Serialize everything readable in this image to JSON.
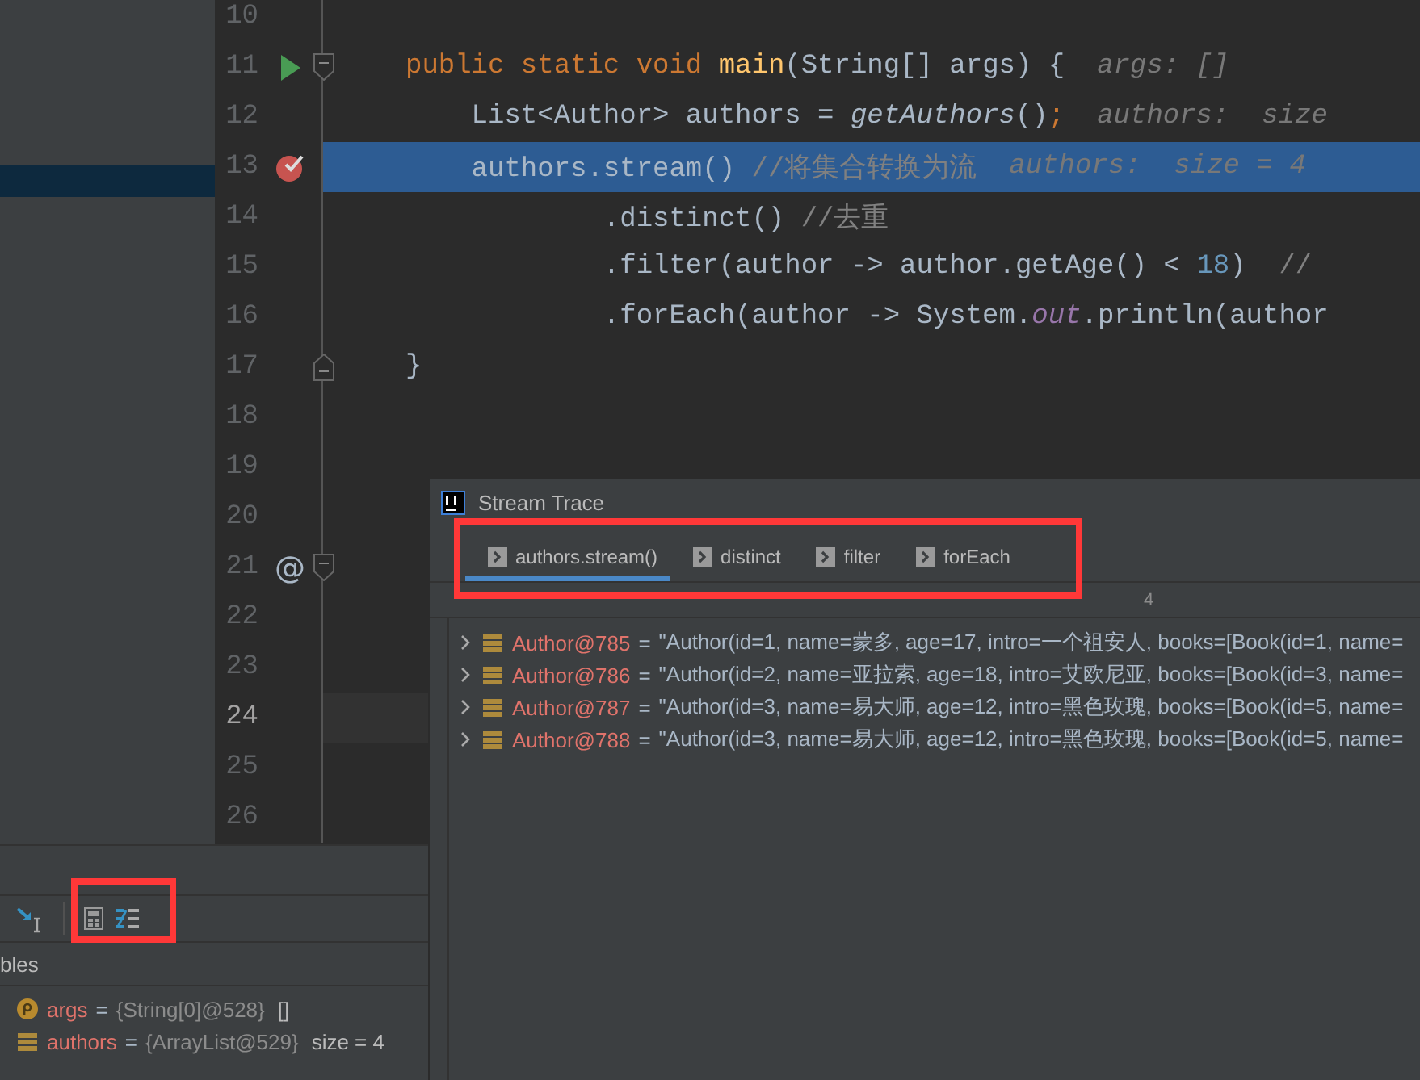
{
  "editor": {
    "lines": [
      {
        "number": "10",
        "current": false,
        "executing": false
      },
      {
        "number": "11",
        "current": false,
        "executing": false,
        "gutter": {
          "kind": "run"
        },
        "fold": {
          "kind": "start"
        },
        "tokens": [
          {
            "kind": "keyword",
            "text": "public static void "
          },
          {
            "kind": "method",
            "text": "main"
          },
          {
            "kind": "plain",
            "text": "(String[] args) {"
          }
        ],
        "hint": "args: []"
      },
      {
        "number": "12",
        "current": false,
        "executing": false,
        "tokens": [
          {
            "kind": "plain",
            "text": "    List<Author> authors = "
          },
          {
            "kind": "call",
            "text": "getAuthors"
          },
          {
            "kind": "plain",
            "text": "()"
          },
          {
            "kind": "keyword",
            "text": ";"
          }
        ],
        "hint": "authors:  size"
      },
      {
        "number": "13",
        "current": false,
        "executing": true,
        "gutter": {
          "kind": "breakpoint"
        },
        "tokens": [
          {
            "kind": "plain",
            "text": "    authors.stream() "
          },
          {
            "kind": "comment",
            "text": "//将集合转换为流"
          }
        ],
        "hint": "authors:  size = 4"
      },
      {
        "number": "14",
        "current": false,
        "executing": false,
        "tokens": [
          {
            "kind": "plain",
            "text": "            .distinct() "
          },
          {
            "kind": "comment",
            "text": "//去重"
          }
        ]
      },
      {
        "number": "15",
        "current": false,
        "executing": false,
        "tokens": [
          {
            "kind": "plain",
            "text": "            .filter(author -> author.getAge() < "
          },
          {
            "kind": "number",
            "text": "18"
          },
          {
            "kind": "plain",
            "text": ")  "
          },
          {
            "kind": "comment",
            "text": "//"
          }
        ]
      },
      {
        "number": "16",
        "current": false,
        "executing": false,
        "tokens": [
          {
            "kind": "plain",
            "text": "            .forEach(author -> System."
          },
          {
            "kind": "field",
            "text": "out"
          },
          {
            "kind": "plain",
            "text": ".println(author"
          }
        ]
      },
      {
        "number": "17",
        "current": false,
        "executing": false,
        "fold": {
          "kind": "end"
        },
        "tokens": [
          {
            "kind": "plain",
            "text": "}"
          }
        ]
      },
      {
        "number": "18",
        "current": false,
        "executing": false
      },
      {
        "number": "19",
        "current": false,
        "executing": false
      },
      {
        "number": "20",
        "current": false,
        "executing": false
      },
      {
        "number": "21",
        "current": false,
        "executing": false,
        "gutter_mark": "@",
        "fold": {
          "kind": "start"
        }
      },
      {
        "number": "22",
        "current": false,
        "executing": false
      },
      {
        "number": "23",
        "current": false,
        "executing": false
      },
      {
        "number": "24",
        "current": true,
        "executing": false
      },
      {
        "number": "25",
        "current": false,
        "executing": false
      },
      {
        "number": "26",
        "current": false,
        "executing": false
      }
    ]
  },
  "debugger": {
    "tab": "bles",
    "variables": [
      {
        "kind": "parameter",
        "name": "args",
        "sign": "=",
        "value": "{String[0]@528}",
        "extra": "[]"
      },
      {
        "kind": "field",
        "name": "authors",
        "sign": "=",
        "value": "{ArrayList@529}",
        "extra": "size = 4"
      }
    ]
  },
  "stream_trace": {
    "title": "Stream Trace",
    "tabs": [
      {
        "label": "authors.stream()",
        "selected": true
      },
      {
        "label": "distinct",
        "selected": false
      },
      {
        "label": "filter",
        "selected": false
      },
      {
        "label": "forEach",
        "selected": false
      }
    ],
    "count": "4",
    "items": [
      {
        "name": "Author@785",
        "sign": "=",
        "value": "\"Author(id=1, name=蒙多, age=17, intro=一个祖安人, books=[Book(id=1, name="
      },
      {
        "name": "Author@786",
        "sign": "=",
        "value": "\"Author(id=2, name=亚拉索, age=18, intro=艾欧尼亚, books=[Book(id=3, name="
      },
      {
        "name": "Author@787",
        "sign": "=",
        "value": "\"Author(id=3, name=易大师, age=12, intro=黑色玫瑰, books=[Book(id=5, name="
      },
      {
        "name": "Author@788",
        "sign": "=",
        "value": "\"Author(id=3, name=易大师, age=12, intro=黑色玫瑰, books=[Book(id=5, name="
      }
    ]
  }
}
